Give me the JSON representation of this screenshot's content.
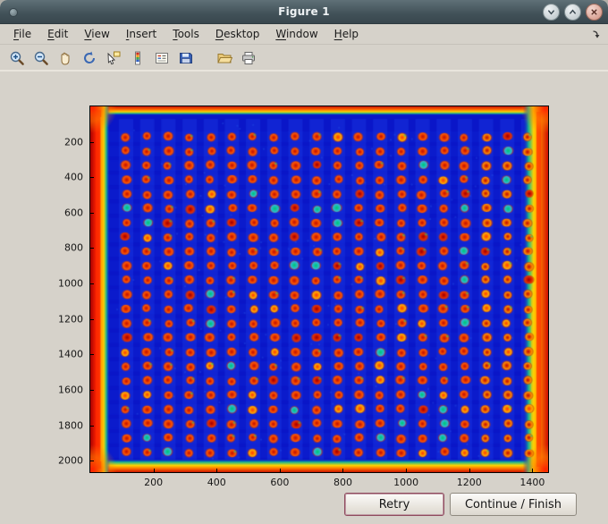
{
  "window": {
    "title": "Figure 1",
    "controls": {
      "minimize": "minimize",
      "maximize": "maximize",
      "close": "close"
    }
  },
  "menubar": {
    "items": [
      "File",
      "Edit",
      "View",
      "Insert",
      "Tools",
      "Desktop",
      "Window",
      "Help"
    ]
  },
  "toolbar": {
    "icons": [
      "zoom-in",
      "zoom-out",
      "pan-hand",
      "rotate-3d",
      "data-cursor",
      "insert-colorbar",
      "insert-legend",
      "save",
      "open-folder",
      "print"
    ]
  },
  "plot": {
    "xticks": [
      200,
      400,
      600,
      800,
      1000,
      1200,
      1400
    ],
    "yticks": [
      200,
      400,
      600,
      800,
      1000,
      1200,
      1400,
      1600,
      1800,
      2000
    ],
    "x_max": 1450,
    "y_max": 2065,
    "image": {
      "description": "microarray dot-blot scan shown with jet colormap: blue background, grid of red/orange spots, red-orange saturated borders",
      "grid_rows": 23,
      "grid_cols": 20,
      "background_color": "#0a16c8",
      "dot_core_color": "#c81400",
      "dot_mid_color": "#ff5a00",
      "edge_colors": [
        "#c81400",
        "#ff6a00",
        "#ffd400",
        "#18b890"
      ]
    }
  },
  "buttons": {
    "retry": "Retry",
    "continue": "Continue / Finish"
  }
}
